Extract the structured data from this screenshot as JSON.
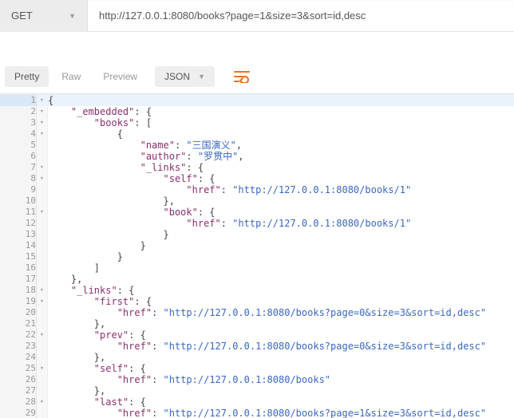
{
  "request": {
    "method": "GET",
    "url": "http://127.0.0.1:8080/books?page=1&size=3&sort=id,desc"
  },
  "view": {
    "tabs": {
      "pretty": "Pretty",
      "raw": "Raw",
      "preview": "Preview"
    },
    "format": "JSON"
  },
  "lines": [
    {
      "n": 1,
      "fold": "▾",
      "hl": true,
      "tokens": [
        [
          "p",
          "{"
        ]
      ]
    },
    {
      "n": 2,
      "fold": "▾",
      "tokens": [
        [
          "p",
          "    "
        ],
        [
          "k",
          "\"_embedded\""
        ],
        [
          "p",
          ": {"
        ]
      ]
    },
    {
      "n": 3,
      "fold": "▾",
      "tokens": [
        [
          "p",
          "        "
        ],
        [
          "k",
          "\"books\""
        ],
        [
          "p",
          ": ["
        ]
      ]
    },
    {
      "n": 4,
      "fold": "▾",
      "tokens": [
        [
          "p",
          "            {"
        ]
      ]
    },
    {
      "n": 5,
      "fold": "",
      "tokens": [
        [
          "p",
          "                "
        ],
        [
          "k",
          "\"name\""
        ],
        [
          "p",
          ": "
        ],
        [
          "s",
          "\"三国演义\""
        ],
        [
          "p",
          ","
        ]
      ]
    },
    {
      "n": 6,
      "fold": "",
      "tokens": [
        [
          "p",
          "                "
        ],
        [
          "k",
          "\"author\""
        ],
        [
          "p",
          ": "
        ],
        [
          "s",
          "\"罗贯中\""
        ],
        [
          "p",
          ","
        ]
      ]
    },
    {
      "n": 7,
      "fold": "▾",
      "tokens": [
        [
          "p",
          "                "
        ],
        [
          "k",
          "\"_links\""
        ],
        [
          "p",
          ": {"
        ]
      ]
    },
    {
      "n": 8,
      "fold": "▾",
      "tokens": [
        [
          "p",
          "                    "
        ],
        [
          "k",
          "\"self\""
        ],
        [
          "p",
          ": {"
        ]
      ]
    },
    {
      "n": 9,
      "fold": "",
      "tokens": [
        [
          "p",
          "                        "
        ],
        [
          "k",
          "\"href\""
        ],
        [
          "p",
          ": "
        ],
        [
          "s",
          "\"http://127.0.0.1:8080/books/1\""
        ]
      ]
    },
    {
      "n": 10,
      "fold": "",
      "tokens": [
        [
          "p",
          "                    },"
        ]
      ]
    },
    {
      "n": 11,
      "fold": "▾",
      "tokens": [
        [
          "p",
          "                    "
        ],
        [
          "k",
          "\"book\""
        ],
        [
          "p",
          ": {"
        ]
      ]
    },
    {
      "n": 12,
      "fold": "",
      "tokens": [
        [
          "p",
          "                        "
        ],
        [
          "k",
          "\"href\""
        ],
        [
          "p",
          ": "
        ],
        [
          "s",
          "\"http://127.0.0.1:8080/books/1\""
        ]
      ]
    },
    {
      "n": 13,
      "fold": "",
      "tokens": [
        [
          "p",
          "                    }"
        ]
      ]
    },
    {
      "n": 14,
      "fold": "",
      "tokens": [
        [
          "p",
          "                }"
        ]
      ]
    },
    {
      "n": 15,
      "fold": "",
      "tokens": [
        [
          "p",
          "            }"
        ]
      ]
    },
    {
      "n": 16,
      "fold": "",
      "tokens": [
        [
          "p",
          "        ]"
        ]
      ]
    },
    {
      "n": 17,
      "fold": "",
      "tokens": [
        [
          "p",
          "    },"
        ]
      ]
    },
    {
      "n": 18,
      "fold": "▾",
      "tokens": [
        [
          "p",
          "    "
        ],
        [
          "k",
          "\"_links\""
        ],
        [
          "p",
          ": {"
        ]
      ]
    },
    {
      "n": 19,
      "fold": "▾",
      "tokens": [
        [
          "p",
          "        "
        ],
        [
          "k",
          "\"first\""
        ],
        [
          "p",
          ": {"
        ]
      ]
    },
    {
      "n": 20,
      "fold": "",
      "tokens": [
        [
          "p",
          "            "
        ],
        [
          "k",
          "\"href\""
        ],
        [
          "p",
          ": "
        ],
        [
          "s",
          "\"http://127.0.0.1:8080/books?page=0&size=3&sort=id,desc\""
        ]
      ]
    },
    {
      "n": 21,
      "fold": "",
      "tokens": [
        [
          "p",
          "        },"
        ]
      ]
    },
    {
      "n": 22,
      "fold": "▾",
      "tokens": [
        [
          "p",
          "        "
        ],
        [
          "k",
          "\"prev\""
        ],
        [
          "p",
          ": {"
        ]
      ]
    },
    {
      "n": 23,
      "fold": "",
      "tokens": [
        [
          "p",
          "            "
        ],
        [
          "k",
          "\"href\""
        ],
        [
          "p",
          ": "
        ],
        [
          "s",
          "\"http://127.0.0.1:8080/books?page=0&size=3&sort=id,desc\""
        ]
      ]
    },
    {
      "n": 24,
      "fold": "",
      "tokens": [
        [
          "p",
          "        },"
        ]
      ]
    },
    {
      "n": 25,
      "fold": "▾",
      "tokens": [
        [
          "p",
          "        "
        ],
        [
          "k",
          "\"self\""
        ],
        [
          "p",
          ": {"
        ]
      ]
    },
    {
      "n": 26,
      "fold": "",
      "tokens": [
        [
          "p",
          "            "
        ],
        [
          "k",
          "\"href\""
        ],
        [
          "p",
          ": "
        ],
        [
          "s",
          "\"http://127.0.0.1:8080/books\""
        ]
      ]
    },
    {
      "n": 27,
      "fold": "",
      "tokens": [
        [
          "p",
          "        },"
        ]
      ]
    },
    {
      "n": 28,
      "fold": "▾",
      "tokens": [
        [
          "p",
          "        "
        ],
        [
          "k",
          "\"last\""
        ],
        [
          "p",
          ": {"
        ]
      ]
    },
    {
      "n": 29,
      "fold": "",
      "tokens": [
        [
          "p",
          "            "
        ],
        [
          "k",
          "\"href\""
        ],
        [
          "p",
          ": "
        ],
        [
          "s",
          "\"http://127.0.0.1:8080/books?page=1&size=3&sort=id,desc\""
        ]
      ]
    }
  ],
  "chart_data": {
    "type": "table",
    "title": "JSON response body",
    "data": {
      "_embedded": {
        "books": [
          {
            "name": "三国演义",
            "author": "罗贯中",
            "_links": {
              "self": {
                "href": "http://127.0.0.1:8080/books/1"
              },
              "book": {
                "href": "http://127.0.0.1:8080/books/1"
              }
            }
          }
        ]
      },
      "_links": {
        "first": {
          "href": "http://127.0.0.1:8080/books?page=0&size=3&sort=id,desc"
        },
        "prev": {
          "href": "http://127.0.0.1:8080/books?page=0&size=3&sort=id,desc"
        },
        "self": {
          "href": "http://127.0.0.1:8080/books"
        },
        "last": {
          "href": "http://127.0.0.1:8080/books?page=1&size=3&sort=id,desc"
        }
      }
    }
  }
}
